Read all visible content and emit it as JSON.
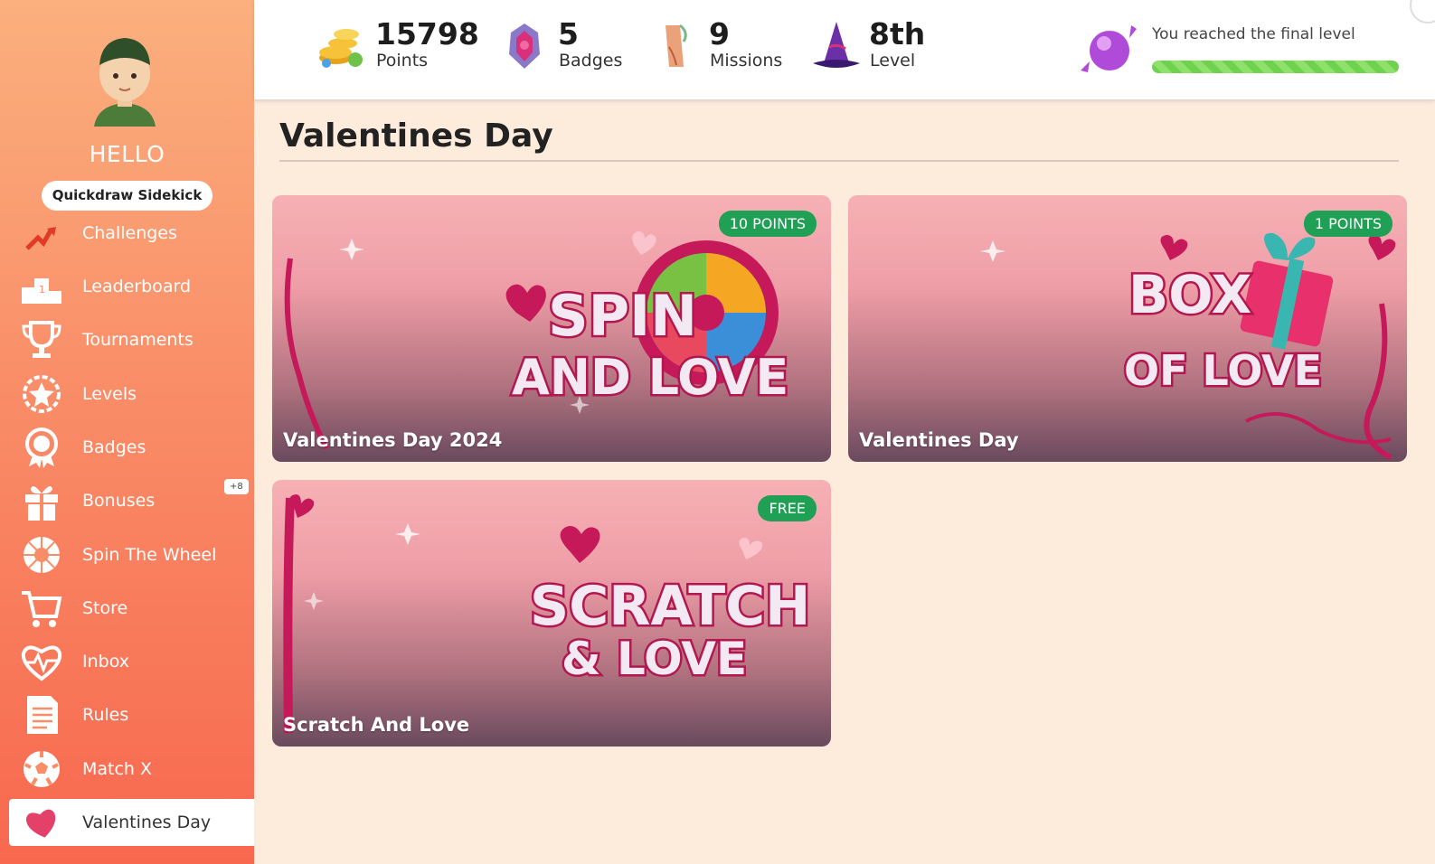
{
  "sidebar": {
    "greeting": "HELLO",
    "username": "Quickdraw Sidekick",
    "items": [
      {
        "label": "Challenges"
      },
      {
        "label": "Leaderboard"
      },
      {
        "label": "Tournaments"
      },
      {
        "label": "Levels"
      },
      {
        "label": "Badges"
      },
      {
        "label": "Bonuses",
        "badge": "+8"
      },
      {
        "label": "Spin The Wheel"
      },
      {
        "label": "Store"
      },
      {
        "label": "Inbox"
      },
      {
        "label": "Rules"
      },
      {
        "label": "Match X"
      },
      {
        "label": "Valentines Day"
      }
    ]
  },
  "stats": {
    "points": {
      "value": "15798",
      "caption": "Points"
    },
    "badges": {
      "value": "5",
      "caption": "Badges"
    },
    "missions": {
      "value": "9",
      "caption": "Missions"
    },
    "level": {
      "value": "8th",
      "caption": "Level"
    },
    "final_level_text": "You reached the final level",
    "progress_fraction": 1.0
  },
  "main": {
    "title": "Valentines Day",
    "cards": [
      {
        "name": "Valentines Day 2024",
        "tag": "10 POINTS",
        "art_title": "SPIN",
        "art_sub": "AND LOVE"
      },
      {
        "name": "Valentines Day",
        "tag": "1 POINTS",
        "art_title": "BOX",
        "art_sub": "OF LOVE"
      },
      {
        "name": "Scratch And Love",
        "tag": "FREE",
        "art_title": "SCRATCH",
        "art_sub": "& LOVE"
      }
    ]
  },
  "colors": {
    "sidebar_top": "#fbb07e",
    "sidebar_bottom": "#f8684f",
    "tag_green": "#1fa055",
    "progress_green": "#6fd24f"
  },
  "icons": [
    "avatar",
    "trophy-arrow-icon",
    "podium-icon",
    "trophy-icon",
    "star-icon",
    "badge-icon",
    "gift-icon",
    "wheel-icon",
    "cart-icon",
    "heart-pulse-icon",
    "document-icon",
    "soccer-ball-icon",
    "heart-icon"
  ]
}
